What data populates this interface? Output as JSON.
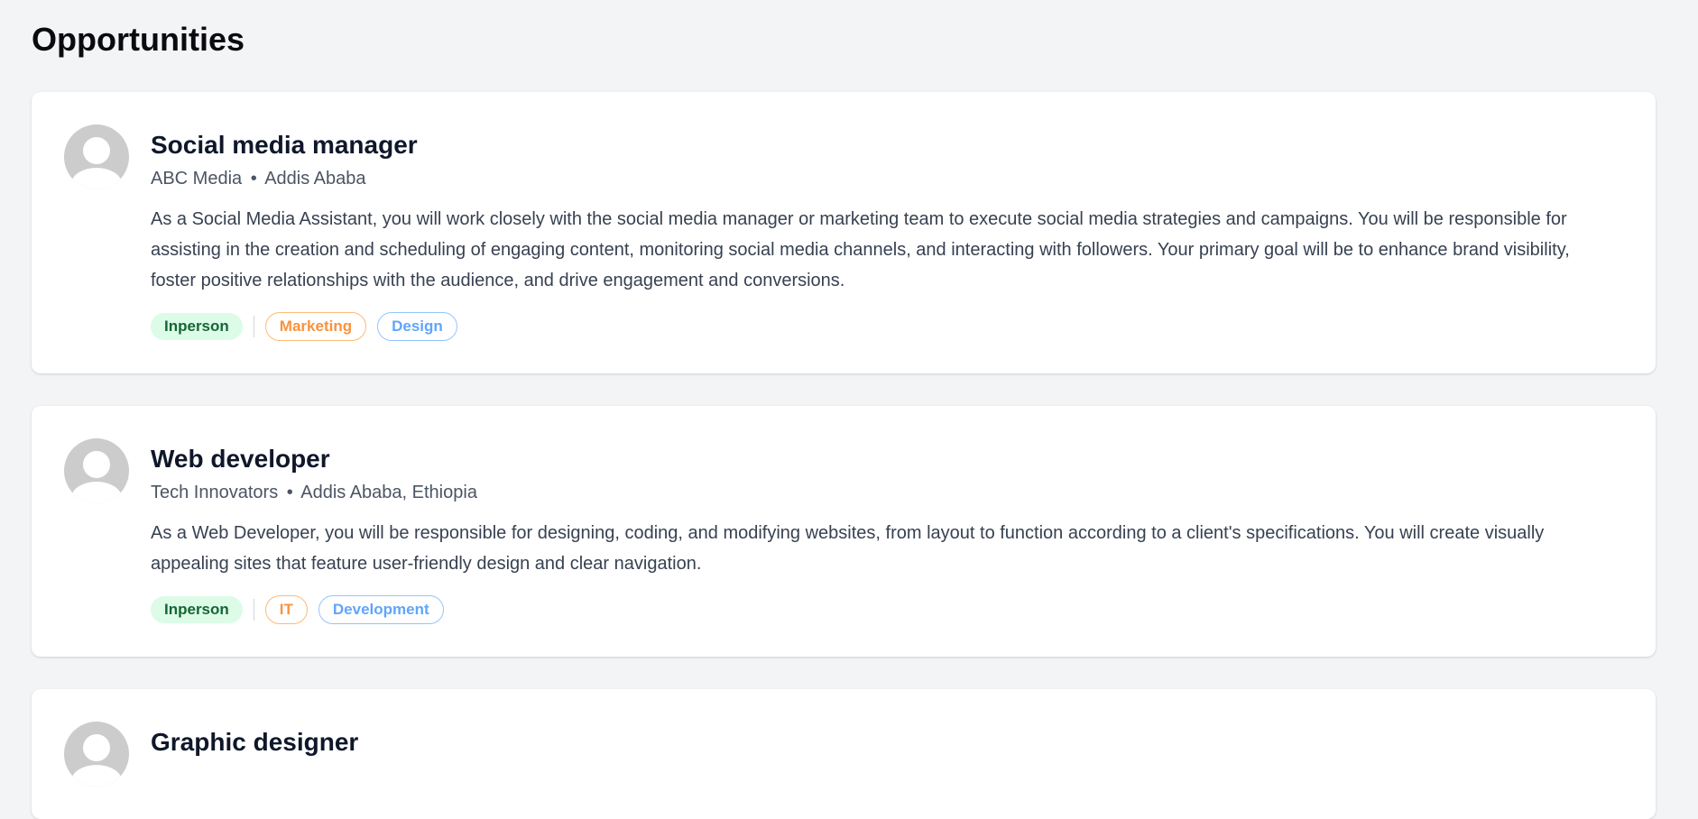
{
  "page": {
    "title": "Opportunities"
  },
  "jobs": [
    {
      "title": "Social media manager",
      "company": "ABC Media",
      "separator": "•",
      "location": "Addis Ababa",
      "description": "As a Social Media Assistant, you will work closely with the social media manager or marketing team to execute social media strategies and campaigns. You will be responsible for assisting in the creation and scheduling of engaging content, monitoring social media channels, and interacting with followers. Your primary goal will be to enhance brand visibility, foster positive relationships with the audience, and drive engagement and conversions.",
      "tags": {
        "type": "Inperson",
        "category1": "Marketing",
        "category2": "Design"
      }
    },
    {
      "title": "Web developer",
      "company": "Tech Innovators",
      "separator": "•",
      "location": "Addis Ababa, Ethiopia",
      "description": "As a Web Developer, you will be responsible for designing, coding, and modifying websites, from layout to function according to a client's specifications. You will create visually appealing sites that feature user-friendly design and clear navigation.",
      "tags": {
        "type": "Inperson",
        "category1": "IT",
        "category2": "Development"
      }
    },
    {
      "title": "Graphic designer"
    }
  ],
  "colors": {
    "background": "#f3f4f6",
    "card": "#ffffff",
    "inperson_bg": "#dcfce7",
    "inperson_text": "#166534",
    "orange_tag": "#fb923c",
    "blue_tag": "#60a5fa"
  },
  "icons": {
    "avatar": "user-avatar-icon"
  }
}
